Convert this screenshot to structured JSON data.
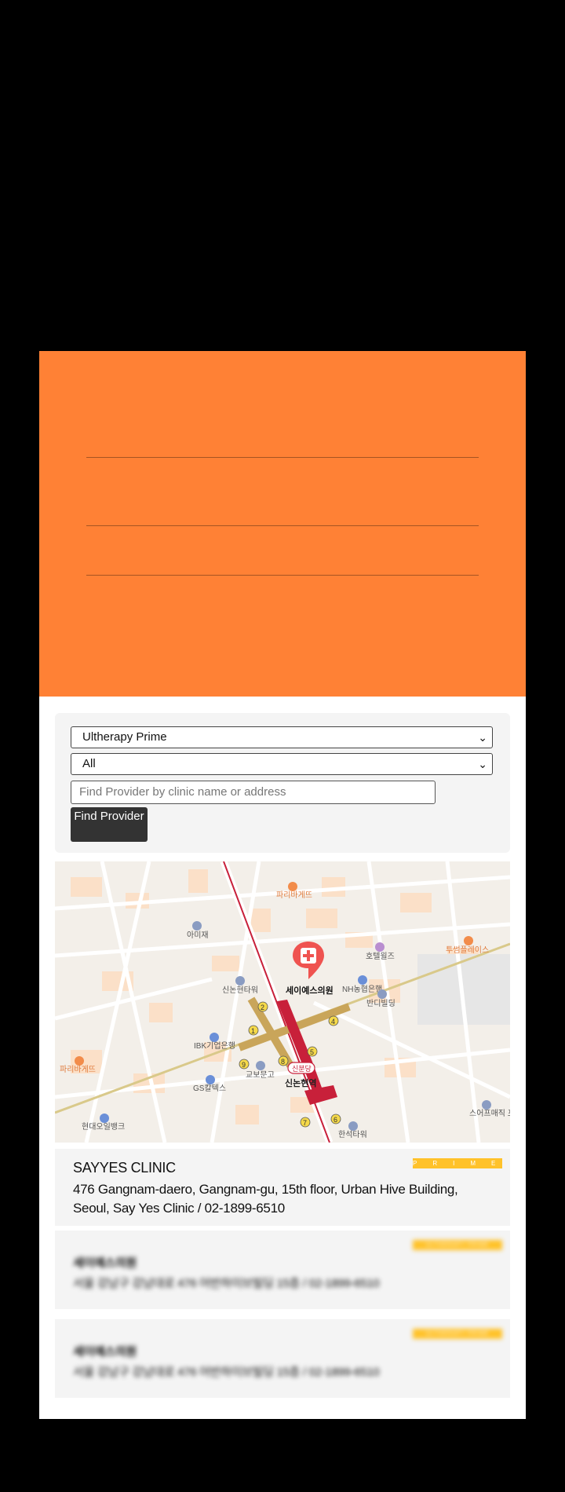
{
  "search": {
    "product_select": "Ultherapy Prime",
    "region_select": "All",
    "provider_placeholder": "Find Provider by clinic name or address",
    "find_button": "Find Provider"
  },
  "map": {
    "clinic_marker_label": "세이예스의원",
    "station_label": "신논현역",
    "station_badge": "신분당",
    "places": [
      "파리바게뜨",
      "아미재",
      "호텔윌즈",
      "투썸플레이스",
      "신논현타워",
      "NH농협은행",
      "반디빌딩",
      "IBK기업은행",
      "교보문고",
      "GS칼텍스",
      "파리바게뜨",
      "현대오일뱅크",
      "한석타워",
      "스어프매직 포레스트"
    ],
    "exit_numbers": [
      "1",
      "2",
      "4",
      "5",
      "6",
      "7",
      "8",
      "9"
    ]
  },
  "results": [
    {
      "name": "SAYYES CLINIC",
      "address": "476 Gangnam-daero, Gangnam-gu, 15th floor, Urban Hive Building, Seoul, Say Yes Clinic / 02-1899-6510",
      "badge": "PRIME"
    },
    {
      "name": "세이예스의원",
      "address": "서울 강남구 강남대로 476 어반하이브빌딩 15층 / 02-1899-6510",
      "badge": "ULTHERAPY PRIME"
    },
    {
      "name": "세이예스의원",
      "address": "서울 강남구 강남대로 476 어반하이브빌딩 15층 / 02-1899-6510",
      "badge": "ULTHERAPY PRIME"
    }
  ],
  "colors": {
    "hero": "#ff8135",
    "badge": "#ffc22a",
    "button": "#333333",
    "subway_line": "#c8203a",
    "subway_passage": "#c9a55a",
    "marker": "#ef5350"
  }
}
